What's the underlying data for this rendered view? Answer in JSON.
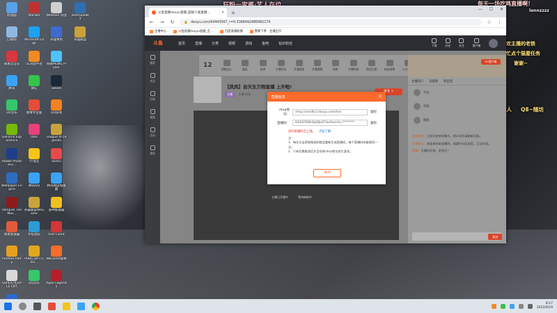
{
  "overlays": {
    "top_center": "狂粉一家酱·艺人在位",
    "top_right_1": "每天一场吃鸡直播啊！",
    "top_right_handle": "lonnzzzz",
    "right_1": "喜欢主播的老铁",
    "right_2": "帮忙点个猫屋任务",
    "right_3": "谢谢~",
    "right_4": "直播间的家人",
    "right_5": "Q8~随坊"
  },
  "desktop": {
    "col1": [
      {
        "label": "此电脑",
        "color": "#5aa0e8"
      },
      {
        "label": "回收站",
        "color": "#8fb8e0"
      },
      {
        "label": "网易云音乐",
        "color": "#d9363e"
      },
      {
        "label": "腾讯",
        "color": "#3aa3f5"
      },
      {
        "label": "QQ音乐",
        "color": "#36c66c"
      },
      {
        "label": "GeForce Experience",
        "color": "#76b900"
      },
      {
        "label": "Adobe Photosho...",
        "color": "#1f3e88"
      },
      {
        "label": "Wallpaper Engine",
        "color": "#2d6cc0"
      },
      {
        "label": "Vampire The Mas...",
        "color": "#8e1b1b"
      },
      {
        "label": "网易加速器",
        "color": "#e05b3c"
      },
      {
        "label": "Punther Party",
        "color": "#e6a020"
      },
      {
        "label": "SUPER PEOPLE CBT",
        "color": "#d9d9d9"
      },
      {
        "label": "Discovery Global Off...",
        "color": "#2a6ad3"
      }
    ],
    "col2": [
      {
        "label": "Naraka",
        "color": "#c03030"
      },
      {
        "label": "Microsoft Edge",
        "color": "#1da1f2"
      },
      {
        "label": "5E对战平台",
        "color": "#f08a24"
      },
      {
        "label": "微信",
        "color": "#35c44b"
      },
      {
        "label": "图像专业版",
        "color": "#e44d3a"
      },
      {
        "label": "idea",
        "color": "#e8407a"
      },
      {
        "label": "YY语音",
        "color": "#f5c518"
      },
      {
        "label": "腾讯QQ",
        "color": "#3aa3f5"
      },
      {
        "label": "英雄联盟WeGame",
        "color": "#c9a23c"
      },
      {
        "label": "罗技鼠标",
        "color": "#2d9bd6"
      },
      {
        "label": "PUBG BATTLEG...",
        "color": "#e0a81e"
      },
      {
        "label": "QQ音乐",
        "color": "#36c66c"
      }
    ],
    "col3": [
      {
        "label": "Netease 对战",
        "color": "#d0d0d0"
      },
      {
        "label": "英雄本色",
        "color": "#3e6bd0"
      },
      {
        "label": "网易MuMu Plyaer",
        "color": "#4dc3ff"
      },
      {
        "label": "Steam",
        "color": "#1b2838"
      },
      {
        "label": "QQ游戏",
        "color": "#f58220"
      },
      {
        "label": "League of Legends",
        "color": "#c9a23c"
      },
      {
        "label": "aiemu",
        "color": "#e84a4a"
      },
      {
        "label": "腾讯网游加速器",
        "color": "#3aa3f5"
      },
      {
        "label": "雷神加速器",
        "color": "#f0c020"
      },
      {
        "label": "Riot Client",
        "color": "#d13639"
      },
      {
        "label": "WeGame版本",
        "color": "#f56c2a"
      },
      {
        "label": "Apex Legends",
        "color": "#b51f2a"
      }
    ],
    "col4": [
      {
        "label": "TeamSpeak 3",
        "color": "#2f6fb1"
      },
      {
        "label": "英雄联盟",
        "color": "#c9a23c"
      }
    ]
  },
  "browser": {
    "tab_title": "斗鱼直播douyu直播_超级人类直播...",
    "new_tab": "+",
    "window_min": "—",
    "window_max": "☐",
    "window_close": "✕",
    "url": "douyu.com/64443567_r=0.3368492486982174",
    "bookmarks": [
      "主播中心",
      "斗鱼直播douyu直播_全...",
      "百度直播助播",
      "我要下单 · 主播出市"
    ]
  },
  "site": {
    "logo": "斗鱼",
    "nav": [
      "首页",
      "直播",
      "分类",
      "视频",
      "游戏",
      "鱼吧",
      "钻石粉丝"
    ],
    "nav_right": [
      "下载",
      "历史",
      "关注",
      "客户端"
    ],
    "left_sidebar": [
      "推荐",
      "关注",
      "分类",
      "视频",
      "活动",
      "更多"
    ],
    "level": "12",
    "gifts": [
      "超能战士",
      "道具",
      "吃鸡",
      "主播任务",
      "开通贵族",
      "开播提醒",
      "钻粉",
      "主播商城",
      "粉丝日报",
      "粉丝勋章",
      "火力全开",
      "任务中心"
    ],
    "stream_title": "【凤凤】自天生万物直播 上开啦!",
    "stream_badge": "主播",
    "streamer_name": "主播 凤凤",
    "follow_label": "关注 +",
    "video_links": [
      "主播已开播中",
      "等待刷新中"
    ],
    "rp_btn": "PC客户端",
    "rp_tabs": [
      "主播排行",
      "贡献榜",
      "粉丝团"
    ],
    "rp_rows": [
      "天仙",
      "贤妻",
      "樱桃"
    ],
    "chat": [
      {
        "name": "系统通知：",
        "text": "已经开启房间模式，倒计时后请刷新页面。"
      },
      {
        "name": "系统提示：",
        "text": "欢迎来到本直播间，请遵守社区规范，互动交流。"
      },
      {
        "name": "弹幕：",
        "text": "主播好厉害，求关注！"
      }
    ],
    "send_label": "发送"
  },
  "dialog": {
    "title": "直播信息",
    "close": "✕",
    "rtmp_label": "rtmp地址：",
    "rtmp_value": "rtmp://sendtc3.douyu.com/live",
    "key_label": "直播码：",
    "key_value": "64443568rQqXJbcD?wsSecret=********",
    "copy_label": "复制",
    "warn": "房间直播码已上线。",
    "help": "点此了解",
    "notes_title": "注：",
    "notes": [
      "1、每次点击获取推流码都会重新生成直播码，每个直播码仅能使用一次。",
      "2、只有切换推流后才会导致rtmp地址发生变化。"
    ],
    "button": "关闭"
  },
  "taskbar": {
    "time": "8:17",
    "date": "2022/6/19"
  }
}
